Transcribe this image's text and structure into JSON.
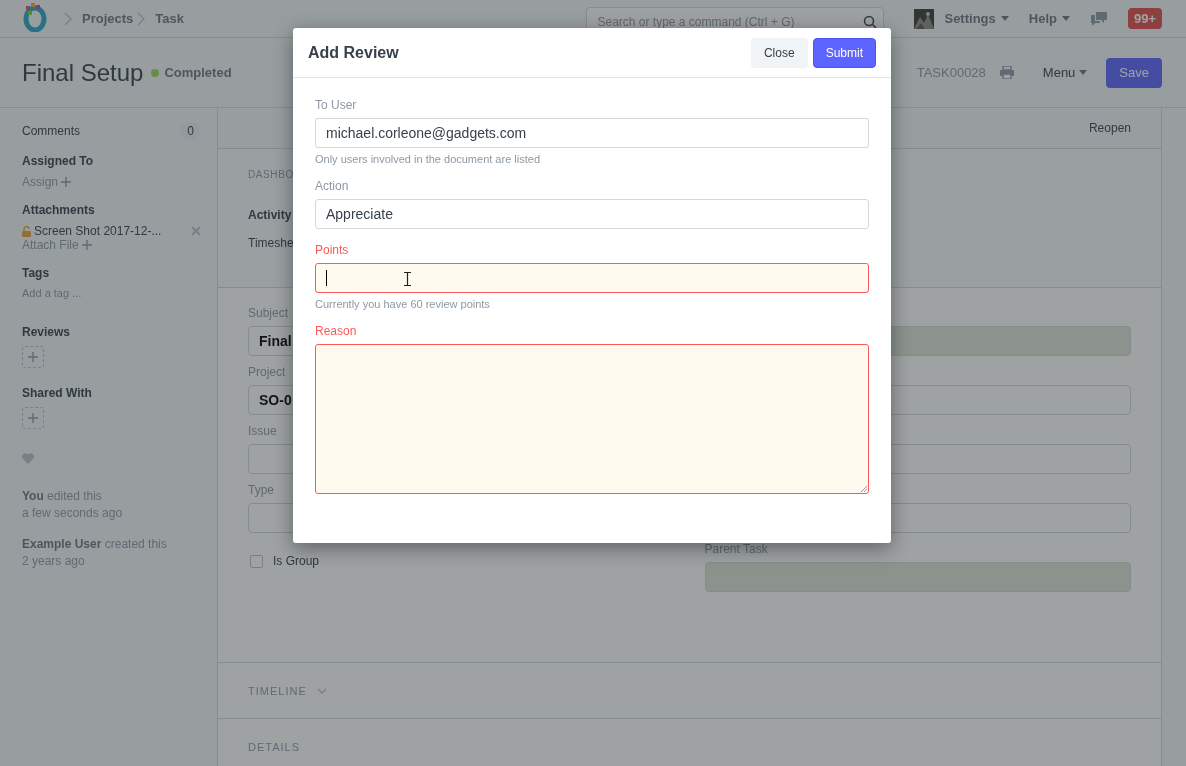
{
  "navbar": {
    "breadcrumbs": [
      "Projects",
      "Task"
    ],
    "search": {
      "placeholder": "Search or type a command (Ctrl + G)"
    },
    "menus": [
      "Settings",
      "Help"
    ],
    "notifications": "99+"
  },
  "page_head": {
    "title": "Final Setup",
    "status": {
      "label": "Completed"
    },
    "doc_id": "TASK00028",
    "menu": "Menu",
    "save": "Save"
  },
  "sidebar": {
    "comments": {
      "label": "Comments",
      "count": "0"
    },
    "assigned": {
      "heading": "Assigned To",
      "action": "Assign"
    },
    "attachments": {
      "heading": "Attachments",
      "files": [
        "Screen Shot 2017-12-..."
      ],
      "action": "Attach File"
    },
    "tags": {
      "heading": "Tags",
      "placeholder": "Add a tag ..."
    },
    "reviews": {
      "heading": "Reviews"
    },
    "shared": {
      "heading": "Shared With"
    },
    "activity": [
      {
        "text": "**You** edited this",
        "time": "a few seconds ago"
      },
      {
        "text": "**Example User** created this",
        "time": "2 years ago"
      }
    ]
  },
  "main": {
    "toolbar": {
      "action": "Reopen"
    },
    "dashboard": {
      "heading": "DASHBO",
      "items": [
        "Activity",
        "Timeshe"
      ]
    },
    "left_fields": [
      {
        "kind": "data",
        "label": "Subject",
        "value": "Final"
      },
      {
        "kind": "data",
        "label": "Project",
        "value": "SO-0"
      },
      {
        "kind": "data",
        "label": "Issue"
      },
      {
        "kind": "data",
        "label": "Type"
      },
      {
        "kind": "check",
        "label": "Is Group",
        "checked": false
      }
    ],
    "right_fields": [
      {
        "readonly": true
      },
      {
        "readonly": false
      },
      {
        "readonly": false
      },
      {
        "readonly": false
      },
      {
        "label": "Parent Task",
        "readonly": true
      }
    ],
    "sections": [
      {
        "label": "TIMELINE",
        "kind": "collapsible"
      },
      {
        "label": "DETAILS",
        "kind": "plain"
      }
    ]
  },
  "modal": {
    "title": "Add Review",
    "buttons": [
      {
        "label": "Close",
        "kind": "default"
      },
      {
        "label": "Submit",
        "kind": "primary"
      }
    ],
    "fields": [
      {
        "kind": "input",
        "label": "To User",
        "value": "michael.corleone@gadgets.com",
        "description": "Only users involved in the document are listed",
        "invalid": false,
        "focused": false
      },
      {
        "kind": "input",
        "label": "Action",
        "value": "Appreciate",
        "invalid": false,
        "focused": false
      },
      {
        "kind": "input",
        "label": "Points",
        "description": "Currently you have 60 review points",
        "invalid": true,
        "focused": true
      },
      {
        "kind": "textarea",
        "label": "Reason",
        "invalid": true,
        "focused": false
      }
    ]
  }
}
